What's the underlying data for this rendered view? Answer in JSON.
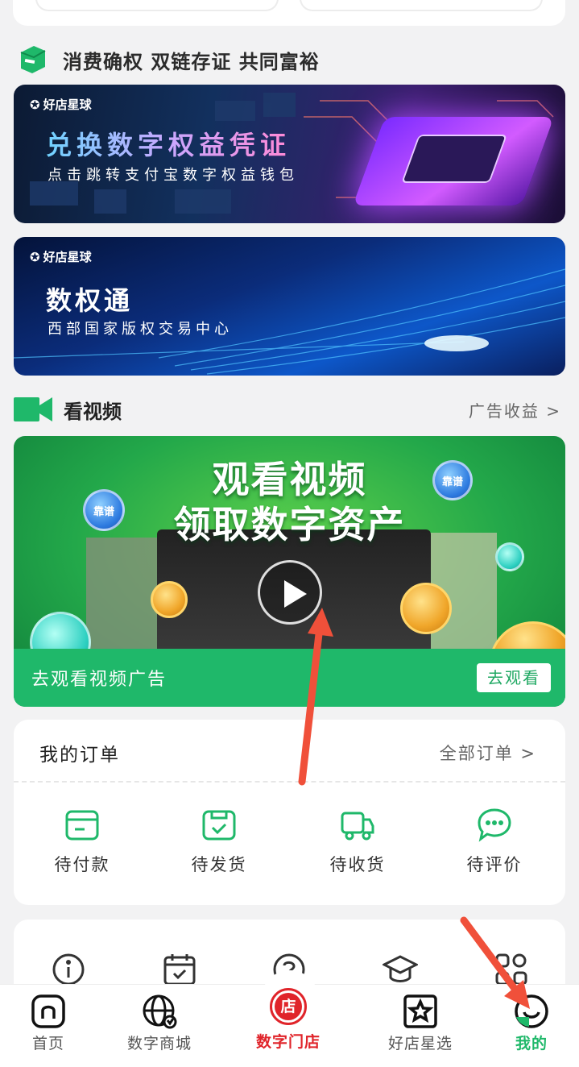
{
  "slogan": {
    "text": "消费确权 双链存证 共同富裕"
  },
  "banners": [
    {
      "brand": "好店星球",
      "title": "兑换数字权益凭证",
      "subtitle": "点击跳转支付宝数字权益钱包"
    },
    {
      "brand": "好店星球",
      "title": "数权通",
      "subtitle": "西部国家版权交易中心"
    }
  ],
  "video_section": {
    "title": "看视频",
    "link": "广告收益 >",
    "card_title_1": "观看视频",
    "card_title_2": "领取数字资产",
    "bubble_1": "靠谱",
    "bubble_2": "靠谱",
    "bar_text": "去观看视频广告",
    "bar_button": "去观看"
  },
  "orders": {
    "title": "我的订单",
    "all_link": "全部订单 >",
    "items": [
      {
        "label": "待付款",
        "icon": "wallet-icon"
      },
      {
        "label": "待发货",
        "icon": "box-check-icon"
      },
      {
        "label": "待收货",
        "icon": "truck-icon"
      },
      {
        "label": "待评价",
        "icon": "comment-icon"
      }
    ]
  },
  "tools": {
    "icons": [
      "info-icon",
      "calendar-icon",
      "help-icon",
      "graduation-cap-icon",
      "apps-icon"
    ]
  },
  "tabbar": {
    "items": [
      {
        "label": "首页",
        "icon": "home-icon"
      },
      {
        "label": "数字商城",
        "icon": "globe-icon"
      },
      {
        "label": "数字门店",
        "icon": "store-icon",
        "center_glyph": "店"
      },
      {
        "label": "好店星选",
        "icon": "star-icon"
      },
      {
        "label": "我的",
        "icon": "profile-icon"
      }
    ],
    "active_index": 4,
    "active_color": "#1fb86a",
    "center_color": "#e0242a"
  },
  "colors": {
    "accent": "#1fb86a",
    "annotation_arrow": "#f0503a"
  }
}
